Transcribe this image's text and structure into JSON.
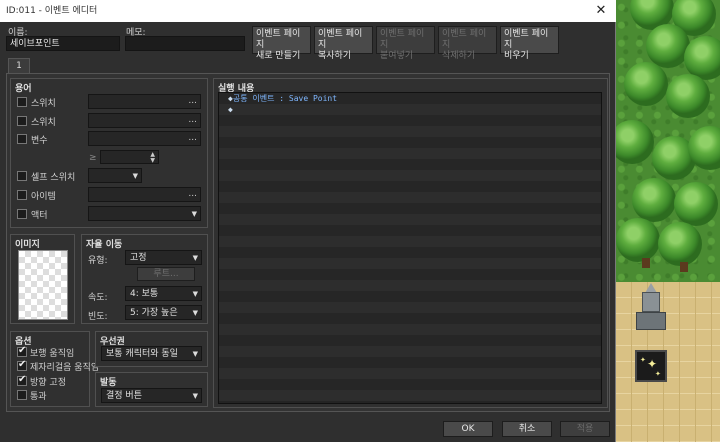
{
  "window": {
    "title": "ID:011 - 이벤트 에디터",
    "close_glyph": "✕"
  },
  "header": {
    "name_label": "이름:",
    "name_value": "세이브포인트",
    "memo_label": "메모:",
    "memo_value": "",
    "page_buttons": [
      {
        "label": "이벤트 페이지\n새로 만들기",
        "enabled": true
      },
      {
        "label": "이벤트 페이지\n복사하기",
        "enabled": true
      },
      {
        "label": "이벤트 페이지\n붙여넣기",
        "enabled": false
      },
      {
        "label": "이벤트 페이지\n삭제하기",
        "enabled": false
      },
      {
        "label": "이벤트 페이지\n비우기",
        "enabled": true
      }
    ]
  },
  "tabs": [
    {
      "label": "1"
    }
  ],
  "conditions": {
    "title": "용어",
    "switch1_label": "스위치",
    "switch2_label": "스위치",
    "variable_label": "변수",
    "compare_symbol": "≥",
    "self_switch_label": "셀프 스위치",
    "item_label": "아이템",
    "actor_label": "액터",
    "dots": "..."
  },
  "image": {
    "title": "이미지"
  },
  "autonomous": {
    "title": "자율 이동",
    "type_label": "유형:",
    "type_value": "고정",
    "route_button": "루트...",
    "speed_label": "속도:",
    "speed_value": "4: 보통",
    "freq_label": "빈도:",
    "freq_value": "5: 가장 높은"
  },
  "options": {
    "title": "옵션",
    "walking": {
      "label": "보행 움직임",
      "checked": true
    },
    "stepping": {
      "label": "제자리걸음 움직임",
      "checked": true
    },
    "direction_fix": {
      "label": "방향 고정",
      "checked": true
    },
    "through": {
      "label": "통과",
      "checked": false
    }
  },
  "priority": {
    "title": "우선권",
    "value": "보통 캐릭터와 동일"
  },
  "trigger": {
    "title": "발동",
    "value": "결정 버튼"
  },
  "contents": {
    "title": "실행 내용",
    "lines": [
      {
        "prefix": "◆",
        "text": "공통 이벤트 : Save Point"
      },
      {
        "prefix": "◆",
        "text": ""
      }
    ]
  },
  "footer": {
    "ok": "OK",
    "cancel": "취소",
    "apply": "적용"
  }
}
